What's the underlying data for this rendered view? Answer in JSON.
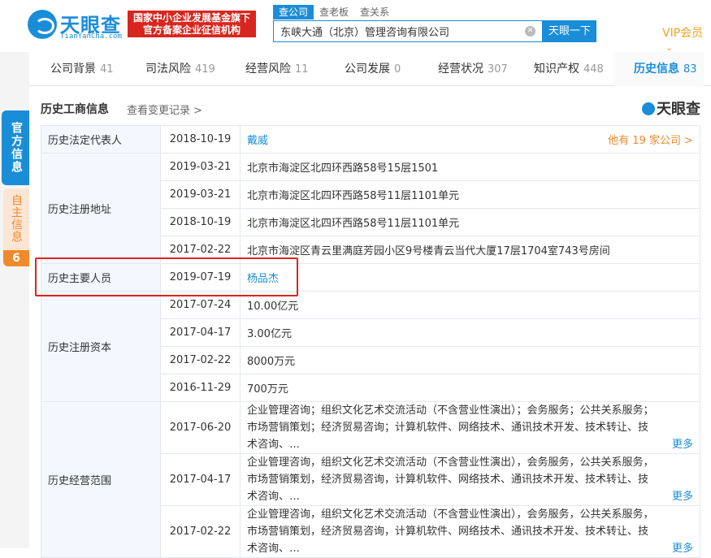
{
  "header": {
    "logo_text": "天眼查",
    "logo_sub": "TianYanCha.com",
    "badge_line1": "国家中小企业发展基金旗下",
    "badge_line2": "官方备案企业征信机构",
    "search_tabs": [
      "查公司",
      "查老板",
      "查关系"
    ],
    "search_value": "东峡大通（北京）管理咨询有限公司",
    "search_button": "天眼一下",
    "vip": "VIP会员"
  },
  "rail": {
    "official": "官方信息",
    "self": "自主信息",
    "self_count": "6"
  },
  "tabs": [
    {
      "label": "公司背景",
      "count": "41"
    },
    {
      "label": "司法风险",
      "count": "419"
    },
    {
      "label": "经营风险",
      "count": "11"
    },
    {
      "label": "公司发展",
      "count": "0"
    },
    {
      "label": "经营状况",
      "count": "307"
    },
    {
      "label": "知识产权",
      "count": "448"
    },
    {
      "label": "历史信息",
      "count": "83"
    }
  ],
  "section": {
    "title": "历史工商信息",
    "link": "查看变更记录 >",
    "watermark": "天眼查"
  },
  "table": {
    "legal_rep": {
      "label": "历史法定代表人",
      "date": "2018-10-19",
      "name": "戴威",
      "more_companies": "他有 19 家公司 >"
    },
    "address": {
      "label": "历史注册地址",
      "rows": [
        {
          "date": "2019-03-21",
          "value": "北京市海淀区北四环西路58号15层1501"
        },
        {
          "date": "2019-03-21",
          "value": "北京市海淀区北四环西路58号11层1101单元"
        },
        {
          "date": "2018-10-19",
          "value": "北京市海淀区北四环西路58号11层1101单元"
        },
        {
          "date": "2017-02-22",
          "value": "北京市海淀区青云里满庭芳园小区9号楼青云当代大厦17层1704室743号房间"
        }
      ]
    },
    "personnel": {
      "label": "历史主要人员",
      "date": "2019-07-19",
      "name": "杨品杰"
    },
    "capital": {
      "label": "历史注册资本",
      "rows": [
        {
          "date": "2017-07-24",
          "value": "10.00亿元"
        },
        {
          "date": "2017-04-17",
          "value": "3.00亿元"
        },
        {
          "date": "2017-02-22",
          "value": "8000万元"
        },
        {
          "date": "2016-11-29",
          "value": "700万元"
        }
      ]
    },
    "scope": {
      "label": "历史经营范围",
      "more": "更多",
      "rows": [
        {
          "date": "2017-06-20",
          "value": "企业管理咨询；组织文化艺术交流活动（不含营业性演出）；会务服务；公共关系服务；市场营销策划；经济贸易咨询；计算机软件、网络技术、通讯技术开发、技术转让、技术咨询、…"
        },
        {
          "date": "2017-04-17",
          "value": "企业管理咨询，组织文化艺术交流活动（不含营业性演出），会务服务，公共关系服务，市场营销策划，经济贸易咨询，计算机软件、网络技术、通讯技术开发、技术转让、技术咨询、…"
        },
        {
          "date": "2017-02-22",
          "value": "企业管理咨询，组织文化艺术交流活动（不含营业性演出），会务服务，公共关系服务，市场营销策划，经济贸易咨询，计算机软件、网络技术、通讯技术开发、技术转让、技术咨询、…"
        }
      ]
    }
  }
}
